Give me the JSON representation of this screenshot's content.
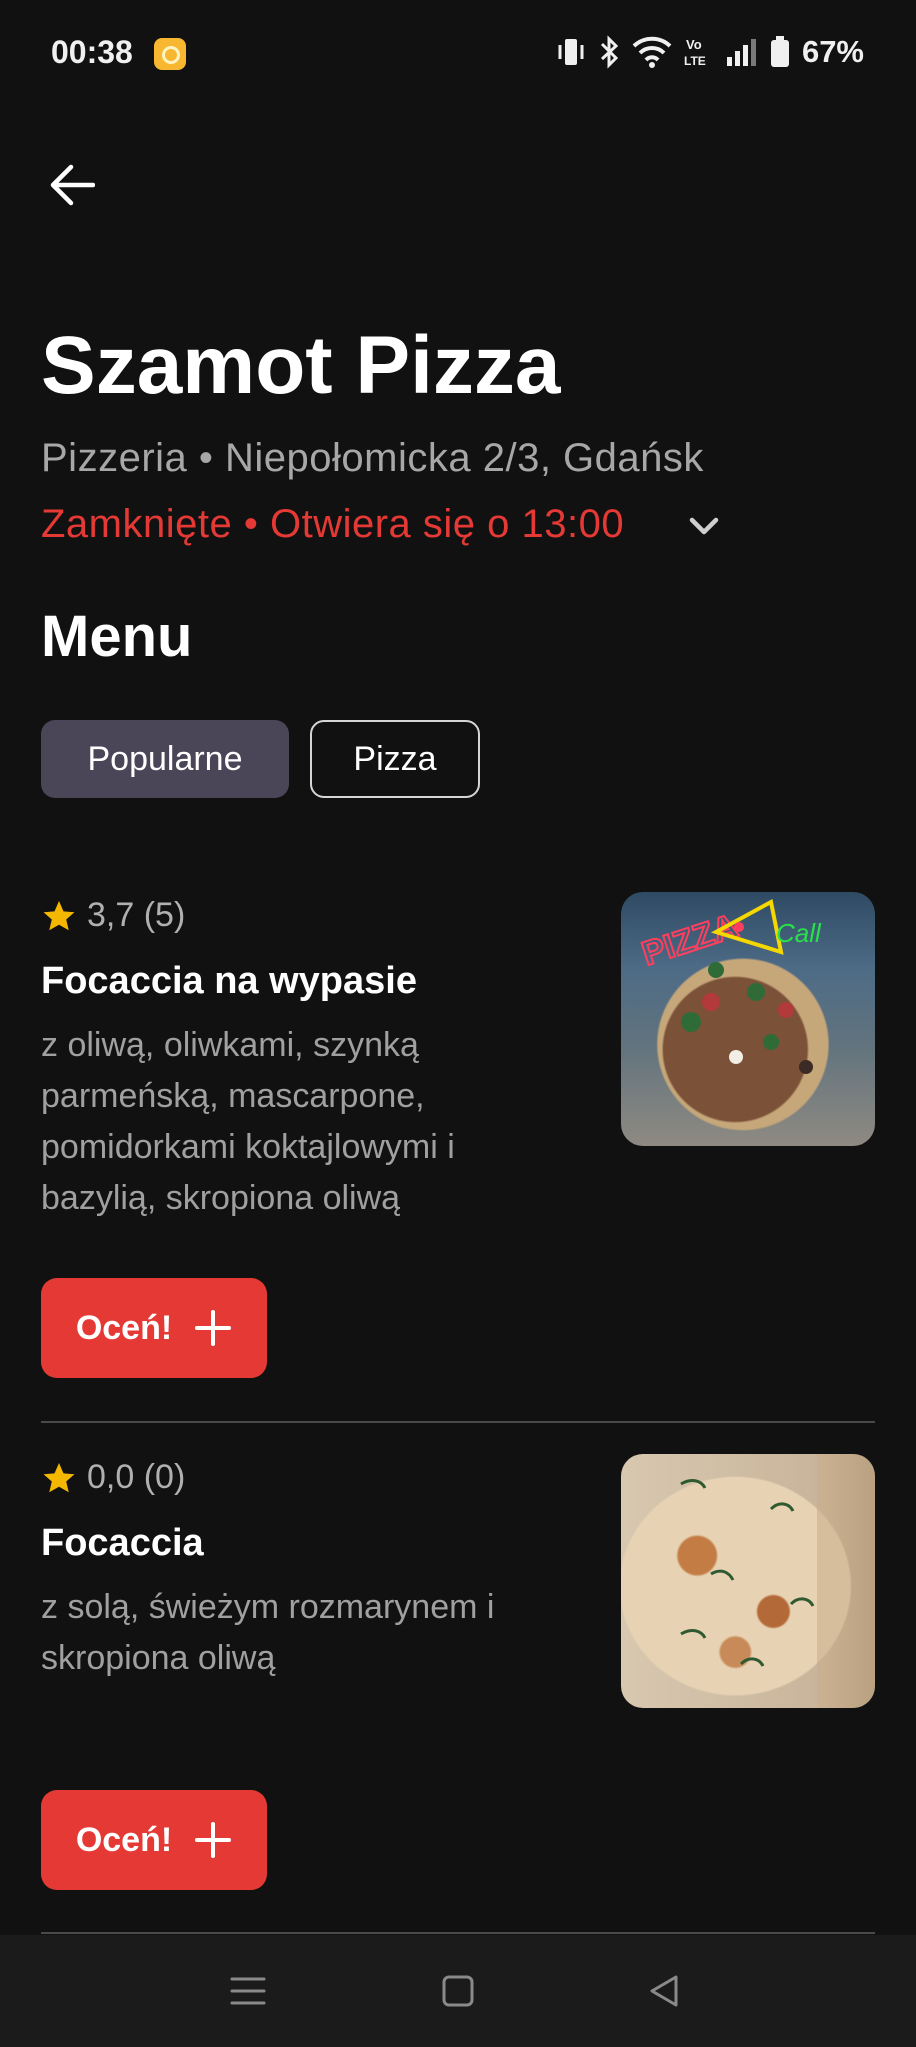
{
  "status_bar": {
    "time": "00:38",
    "battery": "67%",
    "icons": [
      "notification-app-icon",
      "vibrate-icon",
      "bluetooth-icon",
      "wifi-icon",
      "volte-icon",
      "signal-icon",
      "battery-icon"
    ]
  },
  "header": {
    "back_icon": "arrow-left-icon",
    "title": "Szamot Pizza",
    "subtitle": "Pizzeria • Niepołomicka 2/3, Gdańsk",
    "status": "Zamknięte • Otwiera się o 13:00"
  },
  "menu": {
    "heading": "Menu",
    "chips": [
      {
        "label": "Popularne",
        "selected": true
      },
      {
        "label": "Pizza",
        "selected": false
      }
    ],
    "items": [
      {
        "rating": "3,7 (5)",
        "name": "Focaccia na wypasie",
        "description": "z oliwą, oliwkami, szynką parmeńską, mascarpone, pomidorkami koktajlowymi i bazylią, skropiona oliwą",
        "button": "Oceń!"
      },
      {
        "rating": "0,0 (0)",
        "name": "Focaccia",
        "description": "z solą, świeżym rozmarynem i skropiona oliwą",
        "button": "Oceń!"
      }
    ]
  },
  "colors": {
    "background": "#111111",
    "accent_red": "#e53935",
    "star": "#f5b800",
    "chip_selected": "#4a4658"
  }
}
